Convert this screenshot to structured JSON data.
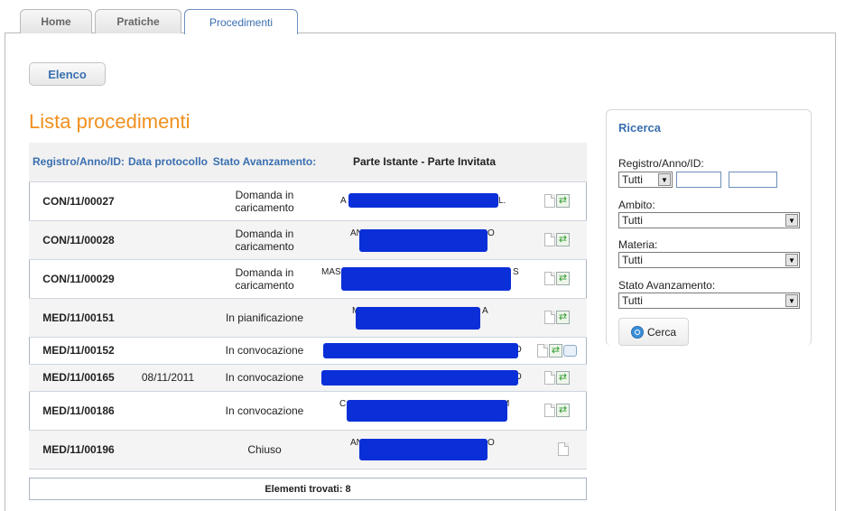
{
  "tabs": [
    {
      "label": "Home"
    },
    {
      "label": "Pratiche"
    },
    {
      "label": "Procedimenti"
    }
  ],
  "elenco_button": "Elenco",
  "title": "Lista procedimenti",
  "table": {
    "headers": [
      "Registro/Anno/ID:",
      "Data protocollo",
      "Stato Avanzamento:",
      "Parte Istante - Parte Invitata"
    ],
    "rows": [
      {
        "reg": "CON/11/00027",
        "data": "",
        "stato": "Domanda in caricamento",
        "parte_left": "A",
        "parte_right": "L."
      },
      {
        "reg": "CON/11/00028",
        "data": "",
        "stato": "Domanda in caricamento",
        "parte_left": "AN",
        "parte_right": "O"
      },
      {
        "reg": "CON/11/00029",
        "data": "",
        "stato": "Domanda in caricamento",
        "parte_left": "MAS",
        "parte_right": "S"
      },
      {
        "reg": "MED/11/00151",
        "data": "",
        "stato": "In pianificazione",
        "parte_left": "M",
        "parte_right": "A"
      },
      {
        "reg": "MED/11/00152",
        "data": "",
        "stato": "In convocazione",
        "parte_left": "",
        "parte_right": "O"
      },
      {
        "reg": "MED/11/00165",
        "data": "08/11/2011",
        "stato": "In convocazione",
        "parte_left": "",
        "parte_right": "O"
      },
      {
        "reg": "MED/11/00186",
        "data": "",
        "stato": "In convocazione",
        "parte_left": "C",
        "parte_right": "M"
      },
      {
        "reg": "MED/11/00196",
        "data": "",
        "stato": "Chiuso",
        "parte_left": "AN",
        "parte_right": "O"
      }
    ]
  },
  "footer": "Elementi trovati: 8",
  "search": {
    "title": "Ricerca",
    "registro_label": "Registro/Anno/ID:",
    "registro_select": "Tutti",
    "ambito_label": "Ambito:",
    "ambito_value": "Tutti",
    "materia_label": "Materia:",
    "materia_value": "Tutti",
    "stato_label": "Stato Avanzamento:",
    "stato_value": "Tutti",
    "cerca_label": "Cerca"
  },
  "colors": {
    "accent": "#3a6fb0",
    "title": "#f0901e",
    "redaction": "#0a2fd8"
  }
}
